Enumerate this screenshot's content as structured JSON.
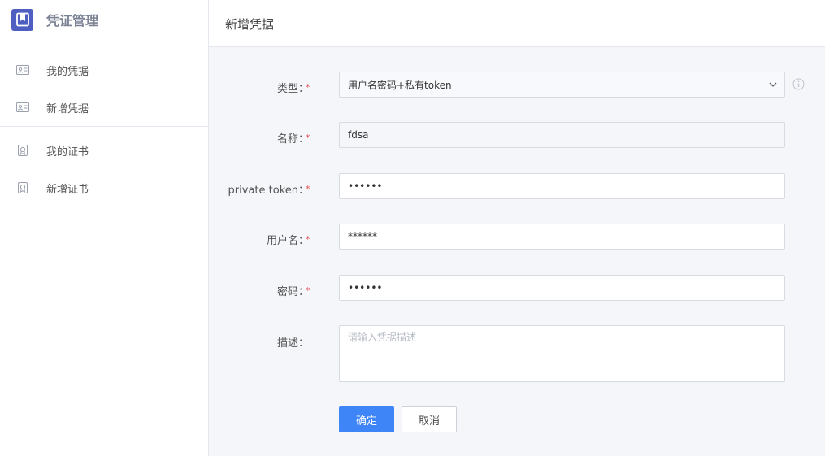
{
  "app": {
    "title": "凭证管理"
  },
  "sidebar": {
    "items": [
      {
        "label": "我的凭据",
        "icon": "id-card-icon"
      },
      {
        "label": "新增凭据",
        "icon": "id-card-icon"
      },
      {
        "label": "我的证书",
        "icon": "certificate-badge-icon"
      },
      {
        "label": "新增证书",
        "icon": "certificate-badge-icon"
      }
    ]
  },
  "page": {
    "title": "新增凭据"
  },
  "form": {
    "required_mark": "*",
    "type": {
      "label": "类型：",
      "value": "用户名密码+私有token"
    },
    "name": {
      "label": "名称：",
      "value": "fdsa"
    },
    "private_token": {
      "label": "private token：",
      "value": "••••••"
    },
    "username": {
      "label": "用户名：",
      "value": "******"
    },
    "password": {
      "label": "密码：",
      "value": "••••••"
    },
    "description": {
      "label": "描述：",
      "placeholder": "请输入凭据描述"
    },
    "buttons": {
      "confirm": "确定",
      "cancel": "取消"
    }
  },
  "colors": {
    "primary": "#3e85f7",
    "brand": "#4f5fc1",
    "required": "#e5484d"
  }
}
